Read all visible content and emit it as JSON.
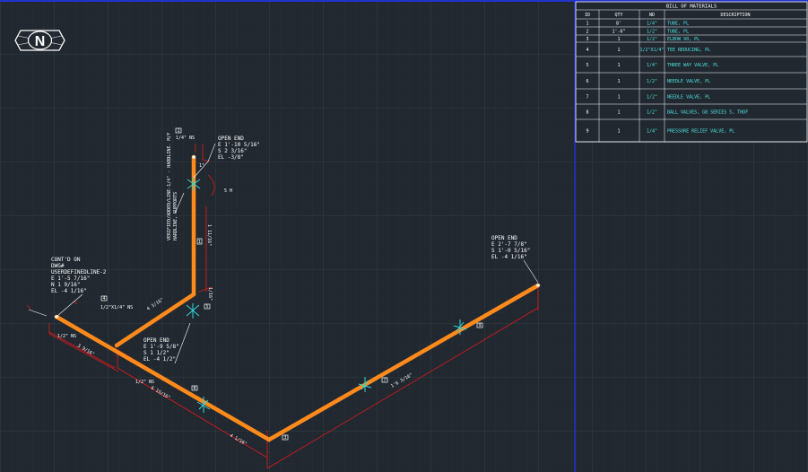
{
  "colors": {
    "background": "#212830",
    "grid_minor": "#2a323b",
    "grid_major": "#36404a",
    "pipe": "#ff8a1c",
    "dimension": "#e01a1a",
    "valve": "#30d8d8",
    "text": "#ffffff",
    "frame": "#2233cc"
  },
  "north_icon": "north-arrow-icon",
  "north_letter": "N",
  "bom": {
    "title": "BILL OF MATERIALS",
    "headers": [
      "ID",
      "QTY",
      "ND",
      "DESCRIPTION"
    ],
    "rows": [
      {
        "id": "1",
        "qty": "8'",
        "nd": "1/4\"",
        "desc": "TUBE, PL"
      },
      {
        "id": "2",
        "qty": "1'-6\"",
        "nd": "1/2\"",
        "desc": "TUBE, PL"
      },
      {
        "id": "3",
        "qty": "1",
        "nd": "1/2\"",
        "desc": "ELBOW 90, PL"
      },
      {
        "id": "4",
        "qty": "1",
        "nd": "1/2\"X1/4\"",
        "desc": "TEE REDUCING, PL"
      },
      {
        "id": "5",
        "qty": "1",
        "nd": "1/4\"",
        "desc": "THREE WAY VALVE, PL"
      },
      {
        "id": "6",
        "qty": "1",
        "nd": "1/2\"",
        "desc": "NEEDLE VALVE, PL"
      },
      {
        "id": "7",
        "qty": "1",
        "nd": "1/2\"",
        "desc": "NEEDLE VALVE, PL"
      },
      {
        "id": "8",
        "qty": "1",
        "nd": "1/2\"",
        "desc": "BALL VALVES, GB SERIES 5, THDF"
      },
      {
        "id": "9",
        "qty": "1",
        "nd": "1/4\"",
        "desc": "PRESSURE RELIEF VALVE, PL"
      }
    ]
  },
  "notes": {
    "open_end_top": [
      "OPEN END",
      "E 1'-10 5/16\"",
      "S 2 3/16\"",
      "EL -3/8\""
    ],
    "open_end_right": [
      "OPEN END",
      "E 2'-7 7/8\"",
      "S 1'-0 5/16\"",
      "EL -4 1/16\""
    ],
    "open_end_mid": [
      "OPEN END",
      "E 1'-9 5/8\"",
      "S 1 1/2\"",
      "EL -4 1/2\""
    ],
    "contd_on": [
      "CONT'D ON",
      "DWG#",
      "USERDEFINEDLINE-2",
      "E 1'-5 7/16\"",
      "N 1 9/16\"",
      "EL -4 1/16\""
    ],
    "vertical_note": [
      "VERIFIED/ADDED/LINE-1/4\" - HARDLINE. M/F",
      "HARDLINE, SUPPORTS"
    ]
  },
  "dims": {
    "d_top_nd": "1/4\" NS",
    "d_1": "1\"",
    "d_vert_len": "1 11/16\"",
    "d_vert_lower": "4 3/16\"",
    "d_tee_size": "1/2\"X1/4\" NS",
    "d_small": "1/16\"",
    "d_left_nd": "1/2\" NS",
    "d_left_len": "3 9/16\"",
    "d_lower_nd": "1/2\" NS",
    "d_lower_len": "6 15/16\"",
    "d_vee_len": "4 1/16\"",
    "d_long_len": "1'6 3/16\"",
    "d_valve_tag": "5 H"
  },
  "tags": {
    "t1": "1",
    "t2": "2",
    "t3": "3",
    "t4": "4",
    "t5": "5",
    "t6": "6",
    "t7": "7",
    "t8": "8",
    "t9": "9"
  }
}
